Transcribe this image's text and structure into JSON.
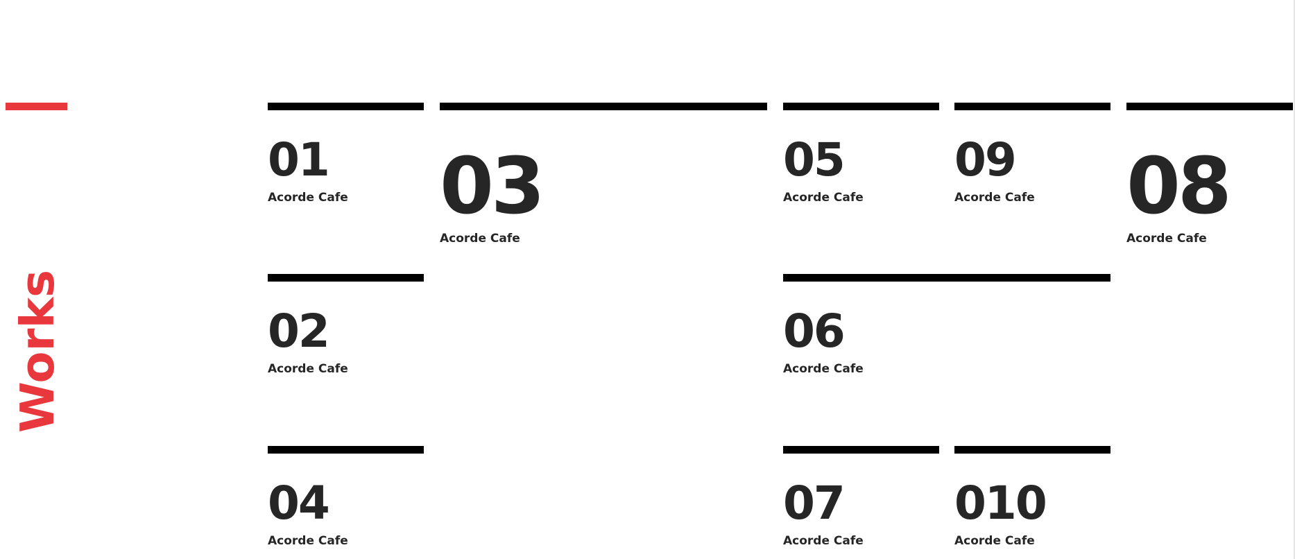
{
  "section": {
    "title": "Works",
    "accent_color": "#e8383d"
  },
  "works": [
    {
      "number": "01",
      "name": "Acorde Cafe"
    },
    {
      "number": "03",
      "name": "Acorde Cafe"
    },
    {
      "number": "05",
      "name": "Acorde Cafe"
    },
    {
      "number": "09",
      "name": "Acorde Cafe"
    },
    {
      "number": "08",
      "name": "Acorde Cafe"
    },
    {
      "number": "02",
      "name": "Acorde Cafe"
    },
    {
      "number": "06",
      "name": "Acorde Cafe"
    },
    {
      "number": "04",
      "name": "Acorde Cafe"
    },
    {
      "number": "07",
      "name": "Acorde Cafe"
    },
    {
      "number": "010",
      "name": "Acorde Cafe"
    }
  ]
}
